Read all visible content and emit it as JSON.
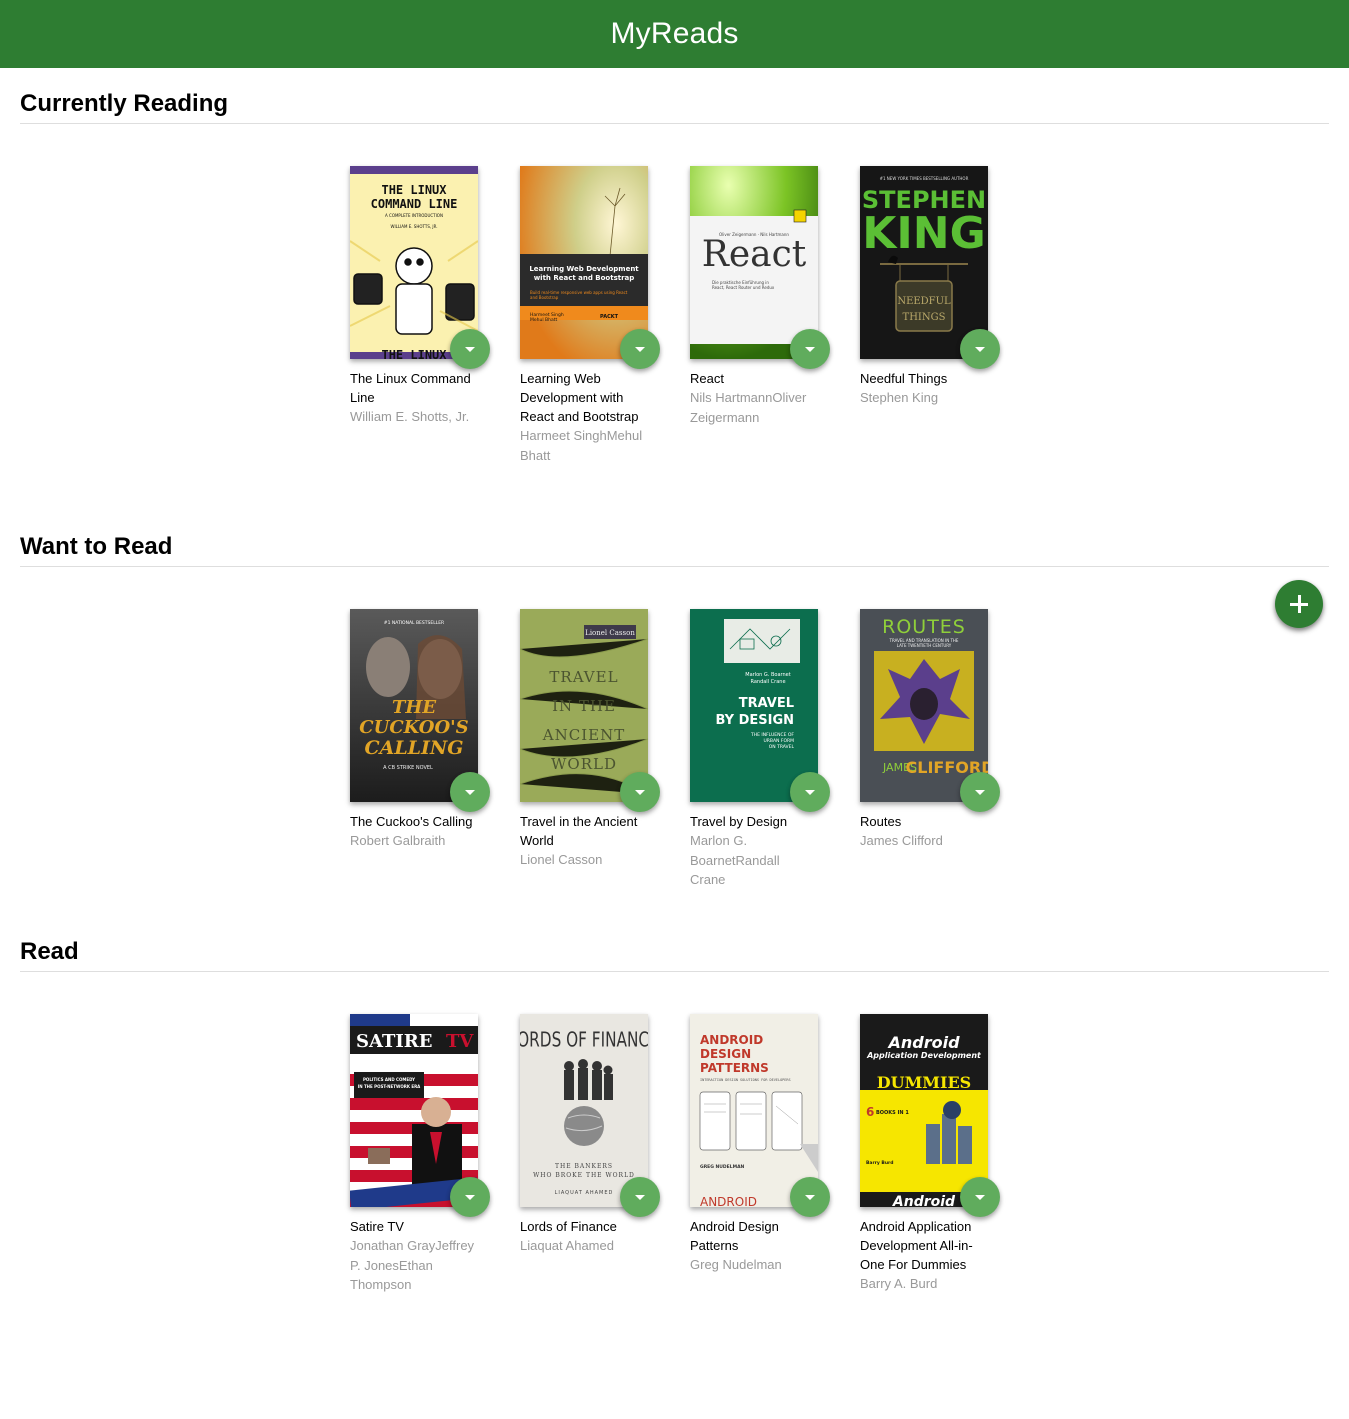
{
  "header": {
    "title": "MyReads"
  },
  "shelves": [
    {
      "title": "Currently Reading",
      "books": [
        {
          "title": "The Linux Command Line",
          "authors": "William E. Shotts, Jr.",
          "cover": {
            "title_text": "THE LINUX COMMAND LINE",
            "subtitle": "A COMPLETE INTRODUCTION",
            "author_text": "WILLIAM E. SHOTTS, JR.",
            "bottom_text": "THE LINUX",
            "bg": "#fbf1b0",
            "band": "#5b3f8c"
          }
        },
        {
          "title": "Learning Web Development with React and Bootstrap",
          "authors": "Harmeet SinghMehul Bhatt",
          "cover": {
            "title_text": "Learning Web Development with React and Bootstrap",
            "subtitle": "Build real-time responsive web apps using React and Bootstrap",
            "author_text": "Harmeet Singh",
            "author_text_2": "Mehul Bhatt",
            "publisher": "PACKT",
            "bg": "#f08a1c",
            "band": "#2b2b2b"
          }
        },
        {
          "title": "React",
          "authors": "Nils HartmannOliver Zeigermann",
          "cover": {
            "title_text": "React",
            "author_text": "Oliver Zeigermann · Nils Hartmann",
            "subtitle": "Die praktische Einführung in React, React Router und Redux",
            "bg": "#7cc425",
            "band": "#f4f4f4"
          }
        },
        {
          "title": "Needful Things",
          "authors": "Stephen King",
          "cover": {
            "title_text": "STEPHEN KING",
            "subtitle": "#1 NEW YORK TIMES BESTSELLING AUTHOR",
            "sign_text": "NEEDFUL THINGS",
            "bg": "#161616",
            "accent": "#5bbf35"
          }
        }
      ]
    },
    {
      "title": "Want to Read",
      "books": [
        {
          "title": "The Cuckoo's Calling",
          "authors": "Robert Galbraith",
          "cover": {
            "title_text": "THE CUCKOO'S CALLING",
            "subtitle": "#1 NATIONAL BESTSELLER",
            "tagline": "A CB STRIKE NOVEL",
            "bg": "#3a3a3a",
            "accent": "#e2a526"
          }
        },
        {
          "title": "Travel in the Ancient World",
          "authors": "Lionel Casson",
          "cover": {
            "title_text": "TRAVEL IN THE ANCIENT WORLD",
            "author_text": "Lionel Casson",
            "bg": "#9aaa59"
          }
        },
        {
          "title": "Travel by Design",
          "authors": "Marlon G. BoarnetRandall Crane",
          "cover": {
            "title_text": "TRAVEL BY DESIGN",
            "author_text": "Marlon G. Boarnet",
            "author_text_2": "Randall Crane",
            "subtitle": "THE INFLUENCE OF URBAN FORM ON TRAVEL",
            "bg": "#0c6e4e"
          }
        },
        {
          "title": "Routes",
          "authors": "James Clifford",
          "cover": {
            "title_text": "ROUTES",
            "subtitle": "TRAVEL AND TRANSLATION IN THE LATE TWENTIETH CENTURY",
            "author_text": "JAMES CLIFFORD",
            "bg": "#4a4f55",
            "accent": "#8fcf3a"
          }
        }
      ]
    },
    {
      "title": "Read",
      "books": [
        {
          "title": "Satire TV",
          "authors": "Jonathan GrayJeffrey P. JonesEthan Thompson",
          "cover": {
            "title_text": "SATIRE",
            "title_text_2": "TV",
            "subtitle": "POLITICS AND COMEDY IN THE POST-NETWORK ERA",
            "bg": "#c8102e",
            "band": "#1a1a1a"
          }
        },
        {
          "title": "Lords of Finance",
          "authors": "Liaquat Ahamed",
          "cover": {
            "title_text": "LORDS OF FINANCE",
            "subtitle": "THE BANKERS WHO BROKE THE WORLD",
            "author_text": "LIAQUAT AHAMED",
            "bg": "#e9e7e1"
          }
        },
        {
          "title": "Android Design Patterns",
          "authors": "Greg Nudelman",
          "cover": {
            "title_text": "ANDROID DESIGN PATTERNS",
            "subtitle": "INTERACTION DESIGN SOLUTIONS FOR DEVELOPERS",
            "author_text": "GREG NUDELMAN",
            "bottom_text": "ANDROID",
            "bg": "#f1efe6",
            "accent": "#c0392b"
          }
        },
        {
          "title": "Android Application Development All-in-One For Dummies",
          "authors": "Barry A. Burd",
          "cover": {
            "title_text": "Android",
            "title_text_2": "Application Development",
            "series": "DUMMIES",
            "badge": "6 BOOKS IN 1",
            "author_text": "Barry Burd",
            "bottom_text": "Android",
            "bg": "#f6e600",
            "band": "#1a1a1a"
          }
        }
      ]
    }
  ],
  "add_button": {
    "label": "Add a book"
  },
  "colors": {
    "header": "#2e7d32",
    "changer": "#60ac5d",
    "authors_text": "#999999"
  }
}
